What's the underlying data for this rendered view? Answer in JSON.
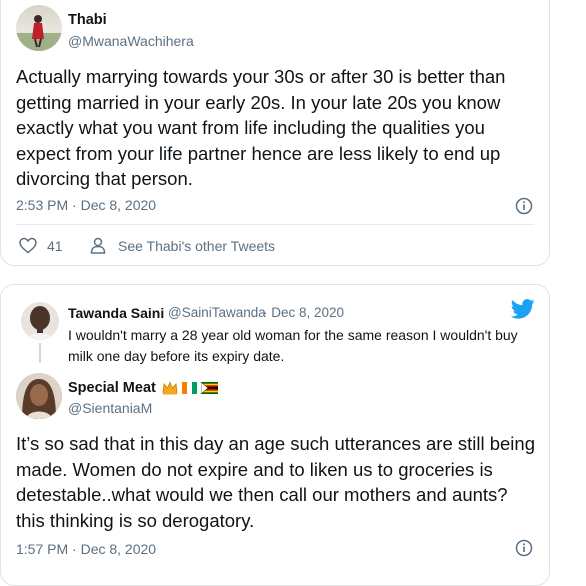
{
  "tweet1": {
    "name": "Thabi",
    "handle": "@MwanaWachihera",
    "text": "Actually marrying towards your 30s or after 30 is better than getting married in your early 20s. In your late 20s you know exactly what you want from life including the qualities you expect from your life partner hence are less likely to end up divorcing that person.",
    "timestamp": "2:53 PM · Dec 8, 2020",
    "likes": "41",
    "other_tweets_label": "See Thabi's other Tweets"
  },
  "tweet2": {
    "quoted": {
      "name": "Tawanda Saini",
      "handle": "@SainiTawanda",
      "date": "· Dec 8, 2020",
      "text": "I wouldn't marry a 28 year old woman for the same reason I wouldn't buy milk one day before its expiry date."
    },
    "reply": {
      "name": "Special Meat",
      "handle": "@SientaniaM",
      "text": "It’s so sad that in this day an age such utterances are still being made. Women do not expire and to liken us to groceries is detestable..what would we then call our mothers and aunts? this thinking is so derogatory.",
      "timestamp": "1:57 PM · Dec 8, 2020"
    }
  },
  "icons": {
    "info": "info-icon",
    "like": "heart-icon",
    "profile": "person-icon",
    "twitter": "twitter-bird-icon",
    "crown": "crown-icon",
    "flags": [
      "ivory-coast-flag",
      "zimbabwe-flag"
    ]
  },
  "colors": {
    "twitter_blue": "#1da1f2",
    "secondary_text": "#5b7083",
    "border": "#dfe3e6"
  }
}
